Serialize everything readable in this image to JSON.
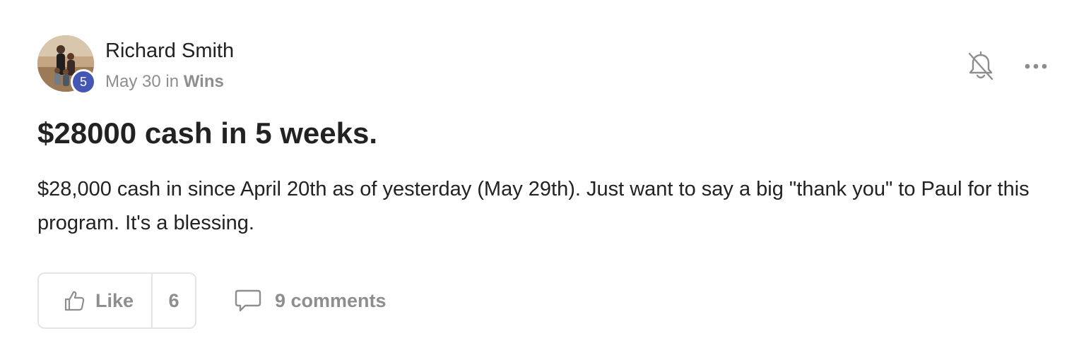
{
  "post": {
    "author": {
      "name": "Richard Smith",
      "level": "5"
    },
    "meta": {
      "date": "May 30",
      "in_text": "in",
      "category": "Wins"
    },
    "title": "$28000 cash in 5 weeks.",
    "body": "$28,000 cash in since April 20th as of yesterday (May 29th). Just want to say a big \"thank you\" to Paul for this program. It's a blessing.",
    "actions": {
      "like_label": "Like",
      "like_count": "6",
      "comments_label": "9 comments"
    },
    "icons": {
      "notifications": "bell-off-icon",
      "more": "more-horizontal-icon",
      "like": "thumbs-up-icon",
      "comments": "comment-bubble-icon"
    },
    "colors": {
      "level_badge": "#4457b5",
      "muted_text": "#8e8e8e",
      "primary_text": "#222222",
      "border": "#e4e4e4"
    }
  }
}
